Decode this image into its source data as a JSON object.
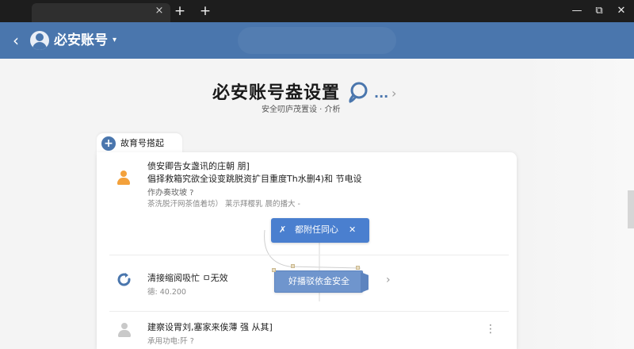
{
  "window": {
    "tab_close": "×",
    "new_tab": "+",
    "new_tab_2": "+",
    "minimize": "—",
    "maximize": "⧉",
    "close": "✕"
  },
  "header": {
    "back": "‹",
    "title": "必安账号",
    "caret": "▾"
  },
  "page": {
    "title": "必安账号盎设置",
    "more": "...",
    "chevron": "›",
    "subtitle": "安全叨庐茂置设 · 介析"
  },
  "card": {
    "tab_icon": "+",
    "tab_label": "故育号搭起"
  },
  "rows": {
    "r1_title": "偾安卿告女盏讯的庄朝 朋]",
    "r1_desc": "倡择救箱究欲全设变跳脱资扩目重度Th水删4)和 节电设",
    "r1_status": "作办奏玫坡  ?",
    "r1_note": "茶洗脱汗网茶值着坊） 莱示拜樱乳 晨的播大 -",
    "r2_title": "清接缩阅吸忙 ㅁ无效",
    "r2_meta": "德: 40.200",
    "r2_chevron": "›",
    "r3_title": "建察设胃刘,塞家来俟薄 强 从其]",
    "r3_meta": "承用功电:阡  ?",
    "r3_more": "⋮"
  },
  "buttons": {
    "primary_x1": "✗",
    "primary_label": "都附任同心",
    "primary_x2": "✕",
    "ribbon_label": "好播驳依金安全"
  },
  "icons": {
    "help": "help-icon",
    "user": "user-icon",
    "refresh": "refresh-icon",
    "person": "person-icon"
  },
  "colors": {
    "header_blue": "#4a76ad",
    "primary_button": "#4a7fcf",
    "ribbon_button": "#6f95cd",
    "user_icon_orange": "#f3a13b"
  }
}
